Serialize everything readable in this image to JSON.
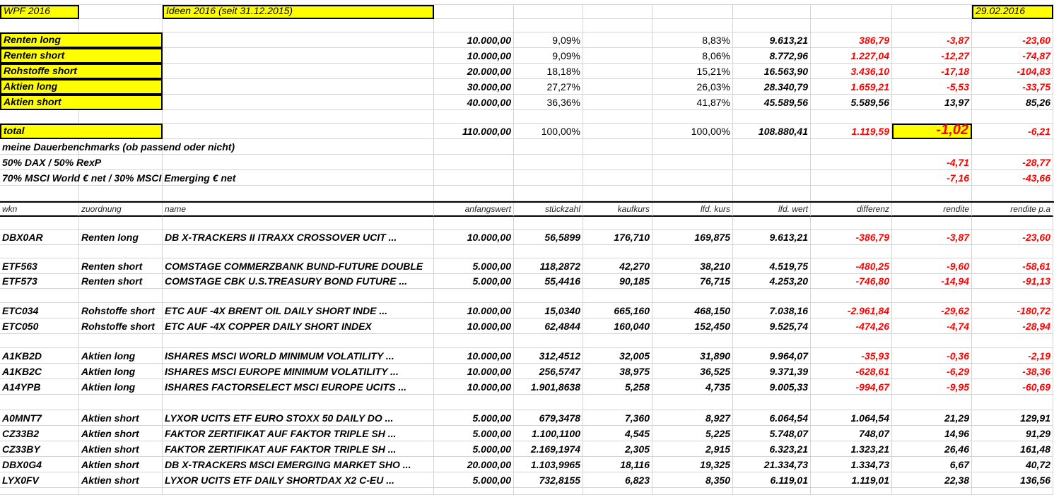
{
  "header": {
    "title": "WPF 2016",
    "subtitle": "Ideen 2016 (seit 31.12.2015)",
    "date": "29.02.2016"
  },
  "colors": {
    "highlight": "#ffff00",
    "negative": "#ff0000",
    "text": "#000000"
  },
  "summary": [
    {
      "label": "Renten long",
      "anfangswert": "10.000,00",
      "anteil": "9,09%",
      "lfd_anteil": "8,83%",
      "lfd_wert": "9.613,21",
      "differenz": "386,79",
      "rendite": "-3,87",
      "rendite_pa": "-23,60",
      "red": true
    },
    {
      "label": "Renten short",
      "anfangswert": "10.000,00",
      "anteil": "9,09%",
      "lfd_anteil": "8,06%",
      "lfd_wert": "8.772,96",
      "differenz": "1.227,04",
      "rendite": "-12,27",
      "rendite_pa": "-74,87",
      "red": true
    },
    {
      "label": "Rohstoffe short",
      "anfangswert": "20.000,00",
      "anteil": "18,18%",
      "lfd_anteil": "15,21%",
      "lfd_wert": "16.563,90",
      "differenz": "3.436,10",
      "rendite": "-17,18",
      "rendite_pa": "-104,83",
      "red": true
    },
    {
      "label": "Aktien long",
      "anfangswert": "30.000,00",
      "anteil": "27,27%",
      "lfd_anteil": "26,03%",
      "lfd_wert": "28.340,79",
      "differenz": "1.659,21",
      "rendite": "-5,53",
      "rendite_pa": "-33,75",
      "red": true
    },
    {
      "label": "Aktien short",
      "anfangswert": "40.000,00",
      "anteil": "36,36%",
      "lfd_anteil": "41,87%",
      "lfd_wert": "45.589,56",
      "differenz": "5.589,56",
      "rendite": "13,97",
      "rendite_pa": "85,26",
      "red": false
    }
  ],
  "total": {
    "label": "total",
    "anfangswert": "110.000,00",
    "anteil": "100,00%",
    "lfd_anteil": "100,00%",
    "lfd_wert": "108.880,41",
    "differenz": "1.119,59",
    "rendite": "-1,02",
    "rendite_pa": "-6,21"
  },
  "benchmarks": {
    "title": "meine Dauerbenchmarks (ob passend oder nicht)",
    "items": [
      {
        "label": "50% DAX / 50% RexP",
        "rendite": "-4,71",
        "rendite_pa": "-28,77"
      },
      {
        "label": "70% MSCI World € net / 30% MSCI Emerging € net",
        "rendite": "-7,16",
        "rendite_pa": "-43,66"
      }
    ]
  },
  "columns": [
    "wkn",
    "zuordnung",
    "name",
    "anfangswert",
    "stückzahl",
    "kaufkurs",
    "lfd. kurs",
    "lfd. wert",
    "differenz",
    "rendite",
    "rendite p.a"
  ],
  "groups": [
    [
      [
        "DBX0AR",
        "Renten long",
        "DB X-TRACKERS II ITRAXX CROSSOVER UCIT ...",
        "10.000,00",
        "56,5899",
        "176,710",
        "169,875",
        "9.613,21",
        "-386,79",
        "-3,87",
        "-23,60"
      ]
    ],
    [
      [
        "ETF563",
        "Renten short",
        "COMSTAGE COMMERZBANK BUND-FUTURE DOUBLE",
        "5.000,00",
        "118,2872",
        "42,270",
        "38,210",
        "4.519,75",
        "-480,25",
        "-9,60",
        "-58,61"
      ],
      [
        "ETF573",
        "Renten short",
        "COMSTAGE CBK U.S.TREASURY BOND FUTURE ...",
        "5.000,00",
        "55,4416",
        "90,185",
        "76,715",
        "4.253,20",
        "-746,80",
        "-14,94",
        "-91,13"
      ]
    ],
    [
      [
        "ETC034",
        "Rohstoffe short",
        "ETC AUF -4X BRENT OIL DAILY SHORT INDE ...",
        "10.000,00",
        "15,0340",
        "665,160",
        "468,150",
        "7.038,16",
        "-2.961,84",
        "-29,62",
        "-180,72"
      ],
      [
        "ETC050",
        "Rohstoffe short",
        "ETC AUF -4X COPPER DAILY SHORT INDEX",
        "10.000,00",
        "62,4844",
        "160,040",
        "152,450",
        "9.525,74",
        "-474,26",
        "-4,74",
        "-28,94"
      ]
    ],
    [
      [
        "A1KB2D",
        "Aktien long",
        "ISHARES MSCI WORLD MINIMUM VOLATILITY ...",
        "10.000,00",
        "312,4512",
        "32,005",
        "31,890",
        "9.964,07",
        "-35,93",
        "-0,36",
        "-2,19"
      ],
      [
        "A1KB2C",
        "Aktien long",
        "ISHARES MSCI EUROPE MINIMUM VOLATILITY ...",
        "10.000,00",
        "256,5747",
        "38,975",
        "36,525",
        "9.371,39",
        "-628,61",
        "-6,29",
        "-38,36"
      ],
      [
        "A14YPB",
        "Aktien long",
        "ISHARES FACTORSELECT MSCI EUROPE UCITS ...",
        "10.000,00",
        "1.901,8638",
        "5,258",
        "4,735",
        "9.005,33",
        "-994,67",
        "-9,95",
        "-60,69"
      ]
    ],
    [
      [
        "A0MNT7",
        "Aktien short",
        "LYXOR UCITS ETF EURO STOXX 50 DAILY DO ...",
        "5.000,00",
        "679,3478",
        "7,360",
        "8,927",
        "6.064,54",
        "1.064,54",
        "21,29",
        "129,91"
      ],
      [
        "CZ33B2",
        "Aktien short",
        "FAKTOR ZERTIFIKAT AUF FAKTOR TRIPLE SH ...",
        "5.000,00",
        "1.100,1100",
        "4,545",
        "5,225",
        "5.748,07",
        "748,07",
        "14,96",
        "91,29"
      ],
      [
        "CZ33BY",
        "Aktien short",
        "FAKTOR ZERTIFIKAT AUF FAKTOR TRIPLE SH ...",
        "5.000,00",
        "2.169,1974",
        "2,305",
        "2,915",
        "6.323,21",
        "1.323,21",
        "26,46",
        "161,48"
      ],
      [
        "DBX0G4",
        "Aktien short",
        "DB X-TRACKERS MSCI EMERGING MARKET SHO ...",
        "20.000,00",
        "1.103,9965",
        "18,116",
        "19,325",
        "21.334,73",
        "1.334,73",
        "6,67",
        "40,72"
      ],
      [
        "LYX0FV",
        "Aktien short",
        "LYXOR UCITS ETF DAILY SHORTDAX X2 C-EU ...",
        "5.000,00",
        "732,8155",
        "6,823",
        "8,350",
        "6.119,01",
        "1.119,01",
        "22,38",
        "136,56"
      ]
    ]
  ]
}
